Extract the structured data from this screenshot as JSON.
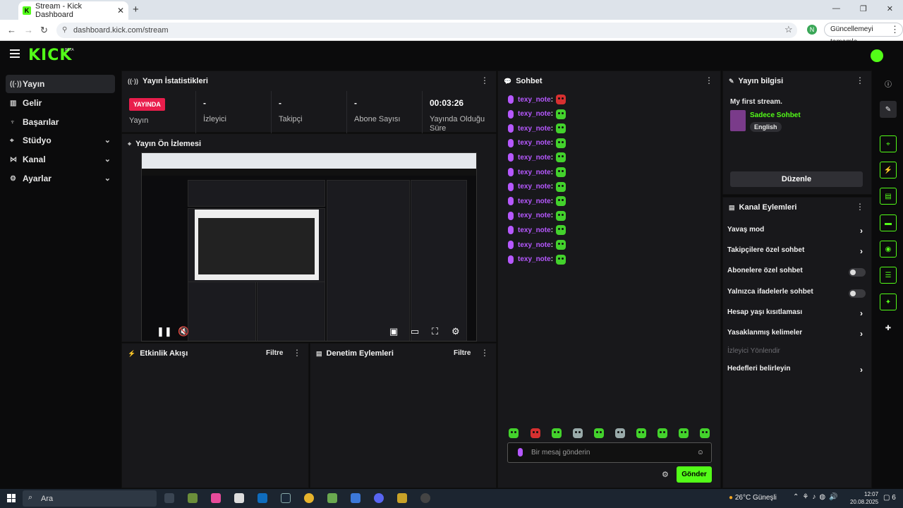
{
  "browser": {
    "tab_title": "Stream - Kick Dashboard",
    "url": "dashboard.kick.com/stream",
    "update_button": "Güncellemeyi tamamla",
    "profile_initial": "N"
  },
  "header": {
    "logo": "KICK",
    "beta": "BETA"
  },
  "nav": [
    {
      "label": "Yayın",
      "icon": "broadcast-icon",
      "active": true
    },
    {
      "label": "Gelir",
      "icon": "revenue-icon"
    },
    {
      "label": "Başarılar",
      "icon": "trophy-icon"
    },
    {
      "label": "Stüdyo",
      "icon": "studio-icon"
    },
    {
      "label": "Kanal",
      "icon": "channel-icon"
    },
    {
      "label": "Ayarlar",
      "icon": "gear-icon"
    }
  ],
  "stats": {
    "title": "Yayın İstatistikleri",
    "live_badge": "YAYINDA",
    "live_label": "Yayın",
    "viewers_value": "-",
    "viewers_label": "İzleyici",
    "followers_value": "-",
    "followers_label": "Takipçi",
    "subs_value": "-",
    "subs_label": "Abone Sayısı",
    "uptime_value": "00:03:26",
    "uptime_label": "Yayında Olduğu Süre"
  },
  "preview": {
    "title": "Yayın Ön İzlemesi"
  },
  "activity": {
    "title": "Etkinlik Akışı",
    "filter": "Filtre"
  },
  "moderation": {
    "title": "Denetim Eylemleri",
    "filter": "Filtre"
  },
  "chat": {
    "title": "Sohbet",
    "messages": [
      {
        "user": "texy_note",
        "emote": "red"
      },
      {
        "user": "texy_note",
        "emote": "green"
      },
      {
        "user": "texy_note",
        "emote": "green"
      },
      {
        "user": "texy_note",
        "emote": "green"
      },
      {
        "user": "texy_note",
        "emote": "green"
      },
      {
        "user": "texy_note",
        "emote": "green"
      },
      {
        "user": "texy_note",
        "emote": "green"
      },
      {
        "user": "texy_note",
        "emote": "green"
      },
      {
        "user": "texy_note",
        "emote": "green"
      },
      {
        "user": "texy_note",
        "emote": "green"
      },
      {
        "user": "texy_note",
        "emote": "green"
      },
      {
        "user": "texy_note",
        "emote": "green"
      }
    ],
    "placeholder": "Bir mesaj gönderin",
    "send": "Gönder"
  },
  "stream_info": {
    "title": "Yayın bilgisi",
    "stream_title": "My first stream.",
    "category": "Sadece Sohbet",
    "language": "English",
    "edit": "Düzenle"
  },
  "channel_actions": {
    "title": "Kanal Eylemleri",
    "items": [
      {
        "label": "Yavaş mod",
        "control": "chevron"
      },
      {
        "label": "Takipçilere özel sohbet",
        "control": "chevron"
      },
      {
        "label": "Abonelere özel sohbet",
        "control": "toggle",
        "on": false
      },
      {
        "label": "Yalnızca ifadelerle sohbet",
        "control": "toggle",
        "on": false
      },
      {
        "label": "Hesap yaşı kısıtlaması",
        "control": "chevron"
      },
      {
        "label": "Yasaklanmış kelimeler",
        "control": "chevron"
      },
      {
        "label": "İzleyici Yönlendir",
        "control": "none",
        "disabled": true
      },
      {
        "label": "Hedefleri belirleyin",
        "control": "chevron"
      }
    ]
  },
  "taskbar": {
    "search": "Ara",
    "weather": "26°C Güneşli",
    "time": "12:07",
    "date": "20.08.2025",
    "notifications": "6"
  },
  "colors": {
    "accent": "#53fc18",
    "live": "#e91e4c",
    "username": "#b658ff"
  }
}
